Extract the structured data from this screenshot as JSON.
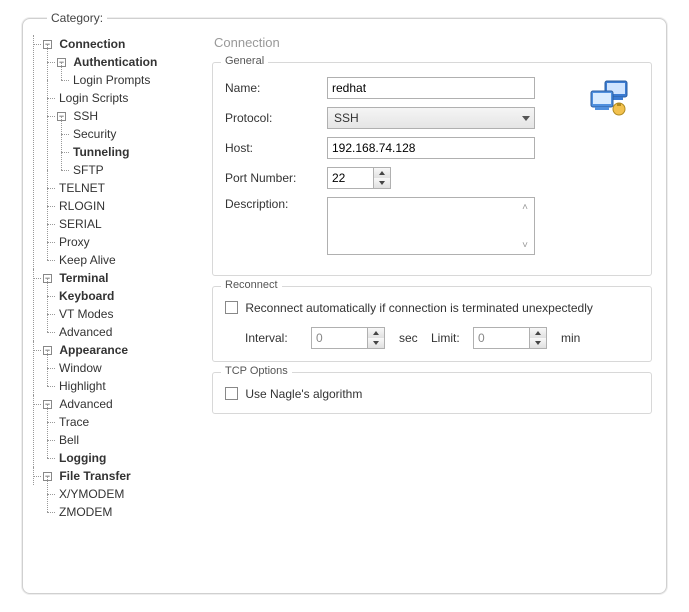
{
  "category_label": "Category:",
  "tree": {
    "connection": "Connection",
    "authentication": "Authentication",
    "login_prompts": "Login Prompts",
    "login_scripts": "Login Scripts",
    "ssh": "SSH",
    "security": "Security",
    "tunneling": "Tunneling",
    "sftp": "SFTP",
    "telnet": "TELNET",
    "rlogin": "RLOGIN",
    "serial": "SERIAL",
    "proxy": "Proxy",
    "keep_alive": "Keep Alive",
    "terminal": "Terminal",
    "keyboard": "Keyboard",
    "vt_modes": "VT Modes",
    "advanced": "Advanced",
    "appearance": "Appearance",
    "window": "Window",
    "highlight": "Highlight",
    "advanced2": "Advanced",
    "trace": "Trace",
    "bell": "Bell",
    "logging": "Logging",
    "file_transfer": "File Transfer",
    "xymodem": "X/YMODEM",
    "zmodem": "ZMODEM"
  },
  "panel": {
    "title": "Connection",
    "general": {
      "legend": "General",
      "name_label": "Name:",
      "name_value": "redhat",
      "protocol_label": "Protocol:",
      "protocol_value": "SSH",
      "host_label": "Host:",
      "host_value": "192.168.74.128",
      "port_label": "Port Number:",
      "port_value": "22",
      "description_label": "Description:",
      "description_value": ""
    },
    "reconnect": {
      "legend": "Reconnect",
      "auto_label": "Reconnect automatically if connection is terminated unexpectedly",
      "interval_label": "Interval:",
      "interval_value": "0",
      "interval_unit": "sec",
      "limit_label": "Limit:",
      "limit_value": "0",
      "limit_unit": "min"
    },
    "tcp": {
      "legend": "TCP Options",
      "nagle_label": "Use Nagle's algorithm"
    }
  },
  "expander_glyph": "−"
}
